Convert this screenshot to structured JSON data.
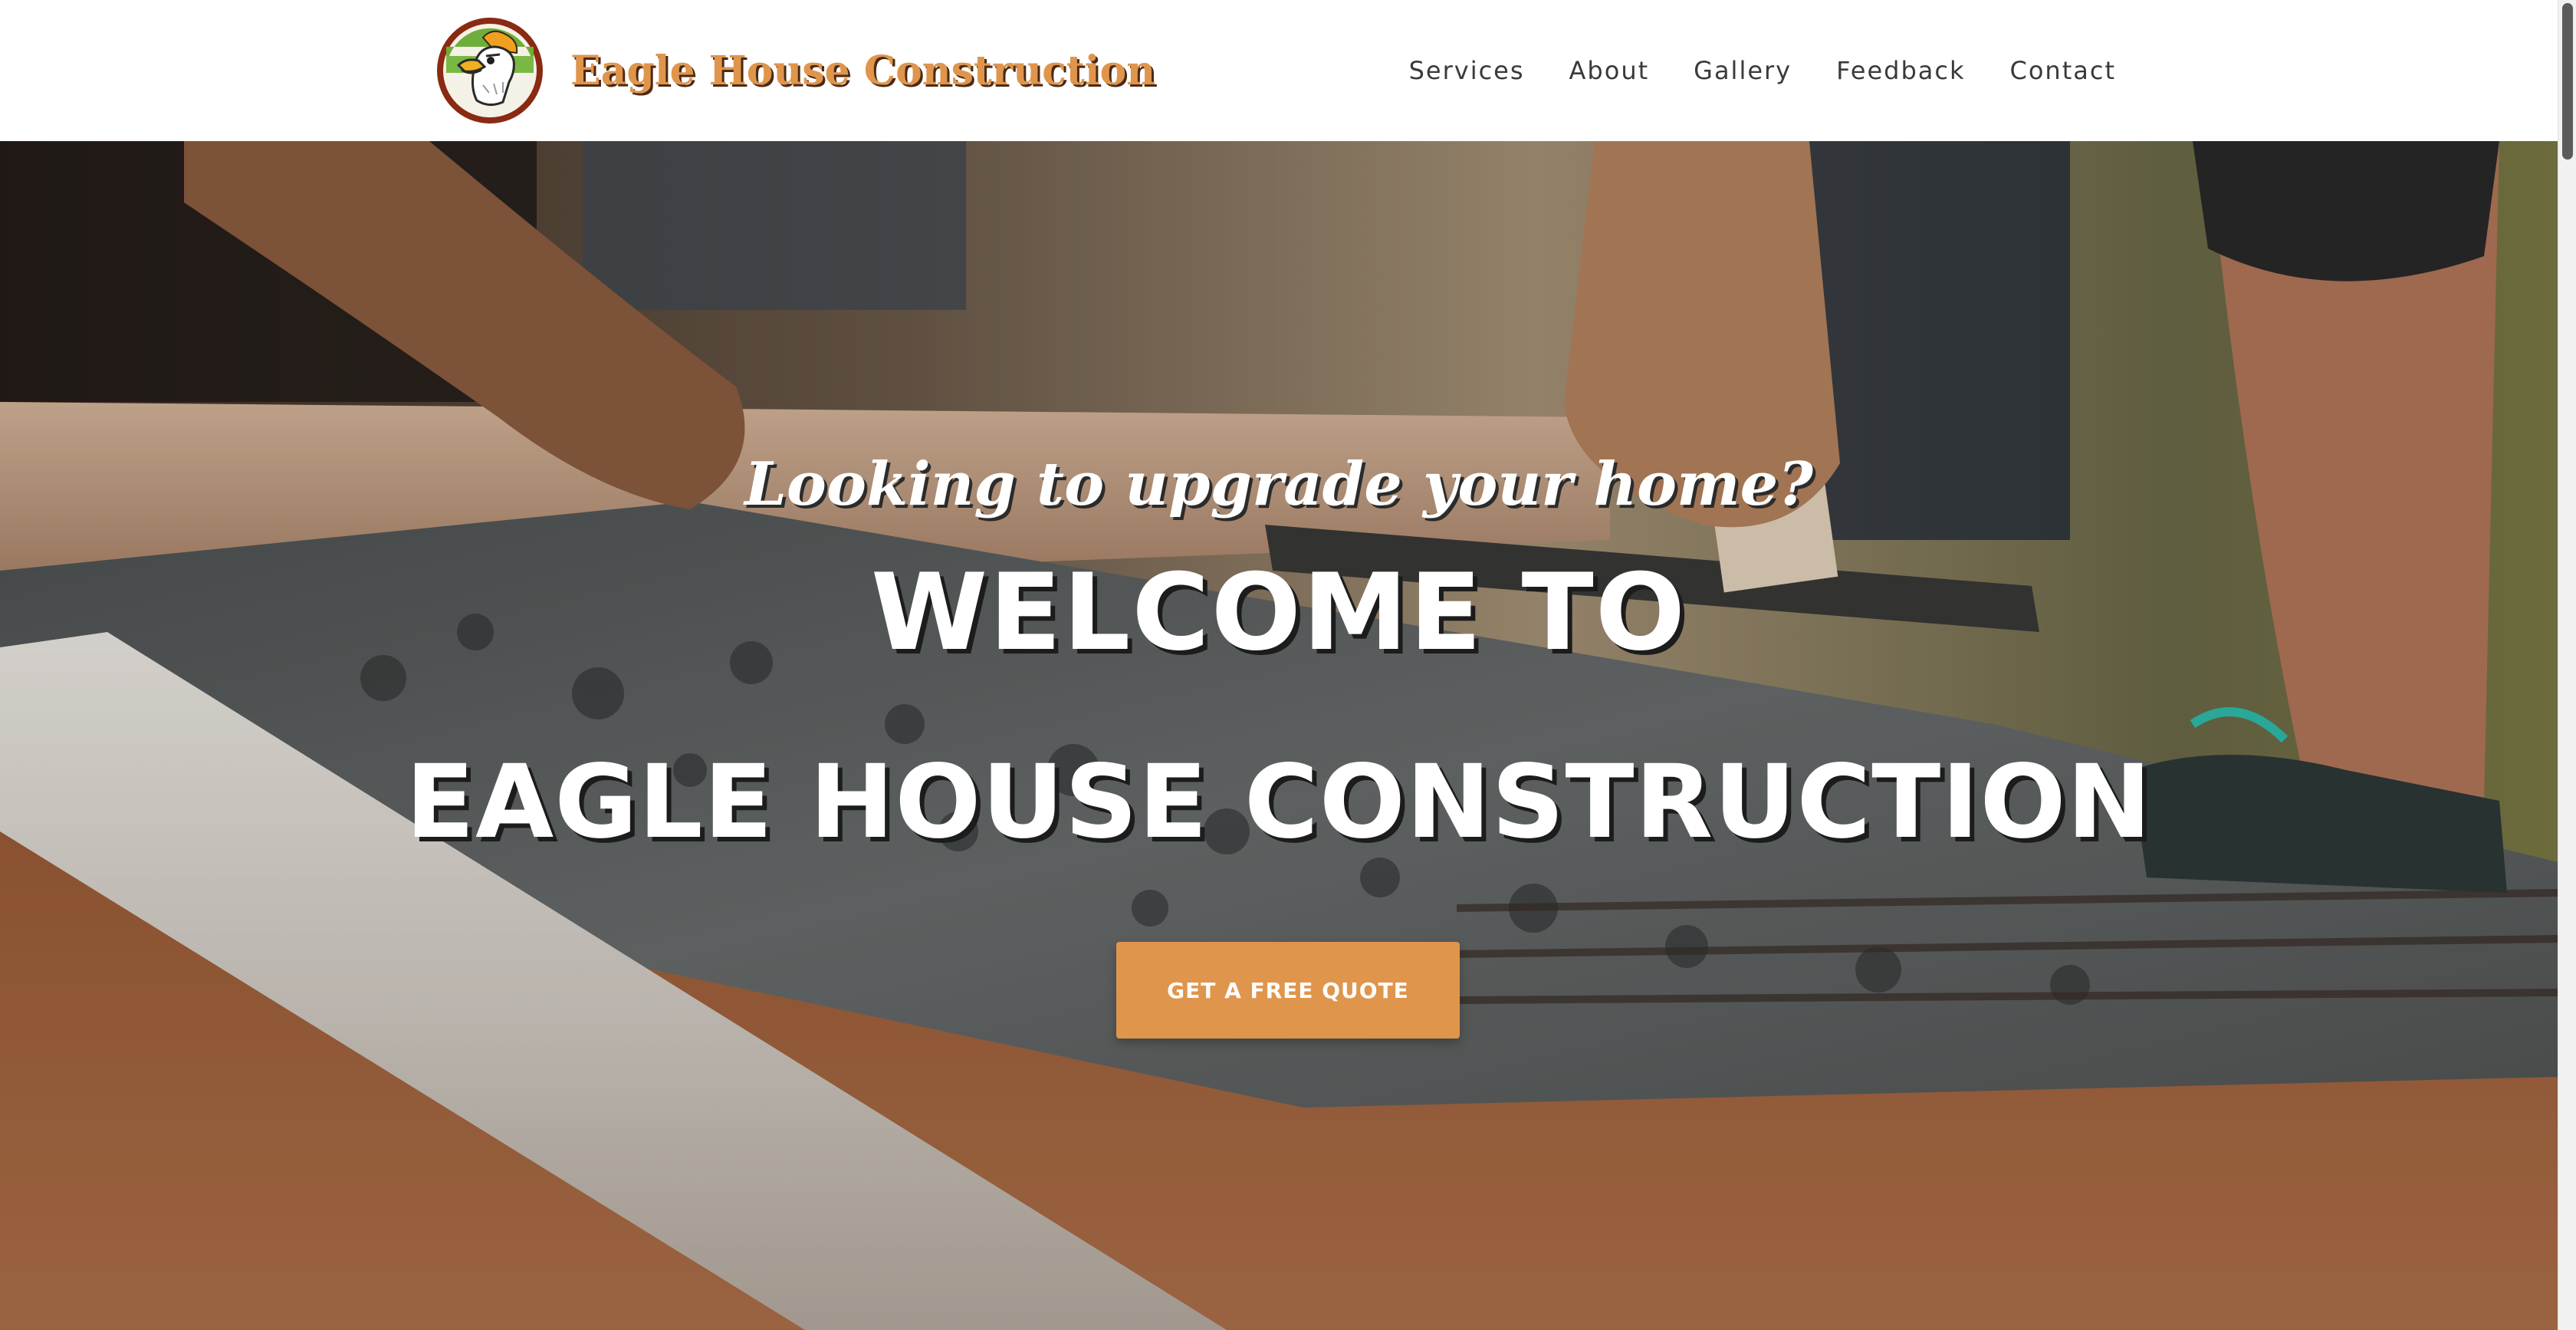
{
  "header": {
    "brand_name": "Eagle House Construction",
    "nav": [
      {
        "label": "Services"
      },
      {
        "label": "About"
      },
      {
        "label": "Gallery"
      },
      {
        "label": "Feedback"
      },
      {
        "label": "Contact"
      }
    ]
  },
  "hero": {
    "tagline": "Looking to upgrade your home?",
    "title_line1": "WELCOME TO",
    "title_line2": "EAGLE HOUSE CONSTRUCTION",
    "cta_label": "GET A FREE QUOTE"
  },
  "icons": {
    "logo": "eagle-logo-icon"
  },
  "colors": {
    "accent": "#e0954c",
    "brand_shadow": "#4a2a14",
    "nav_text": "#3a3a3a",
    "hero_text": "#ffffff"
  }
}
